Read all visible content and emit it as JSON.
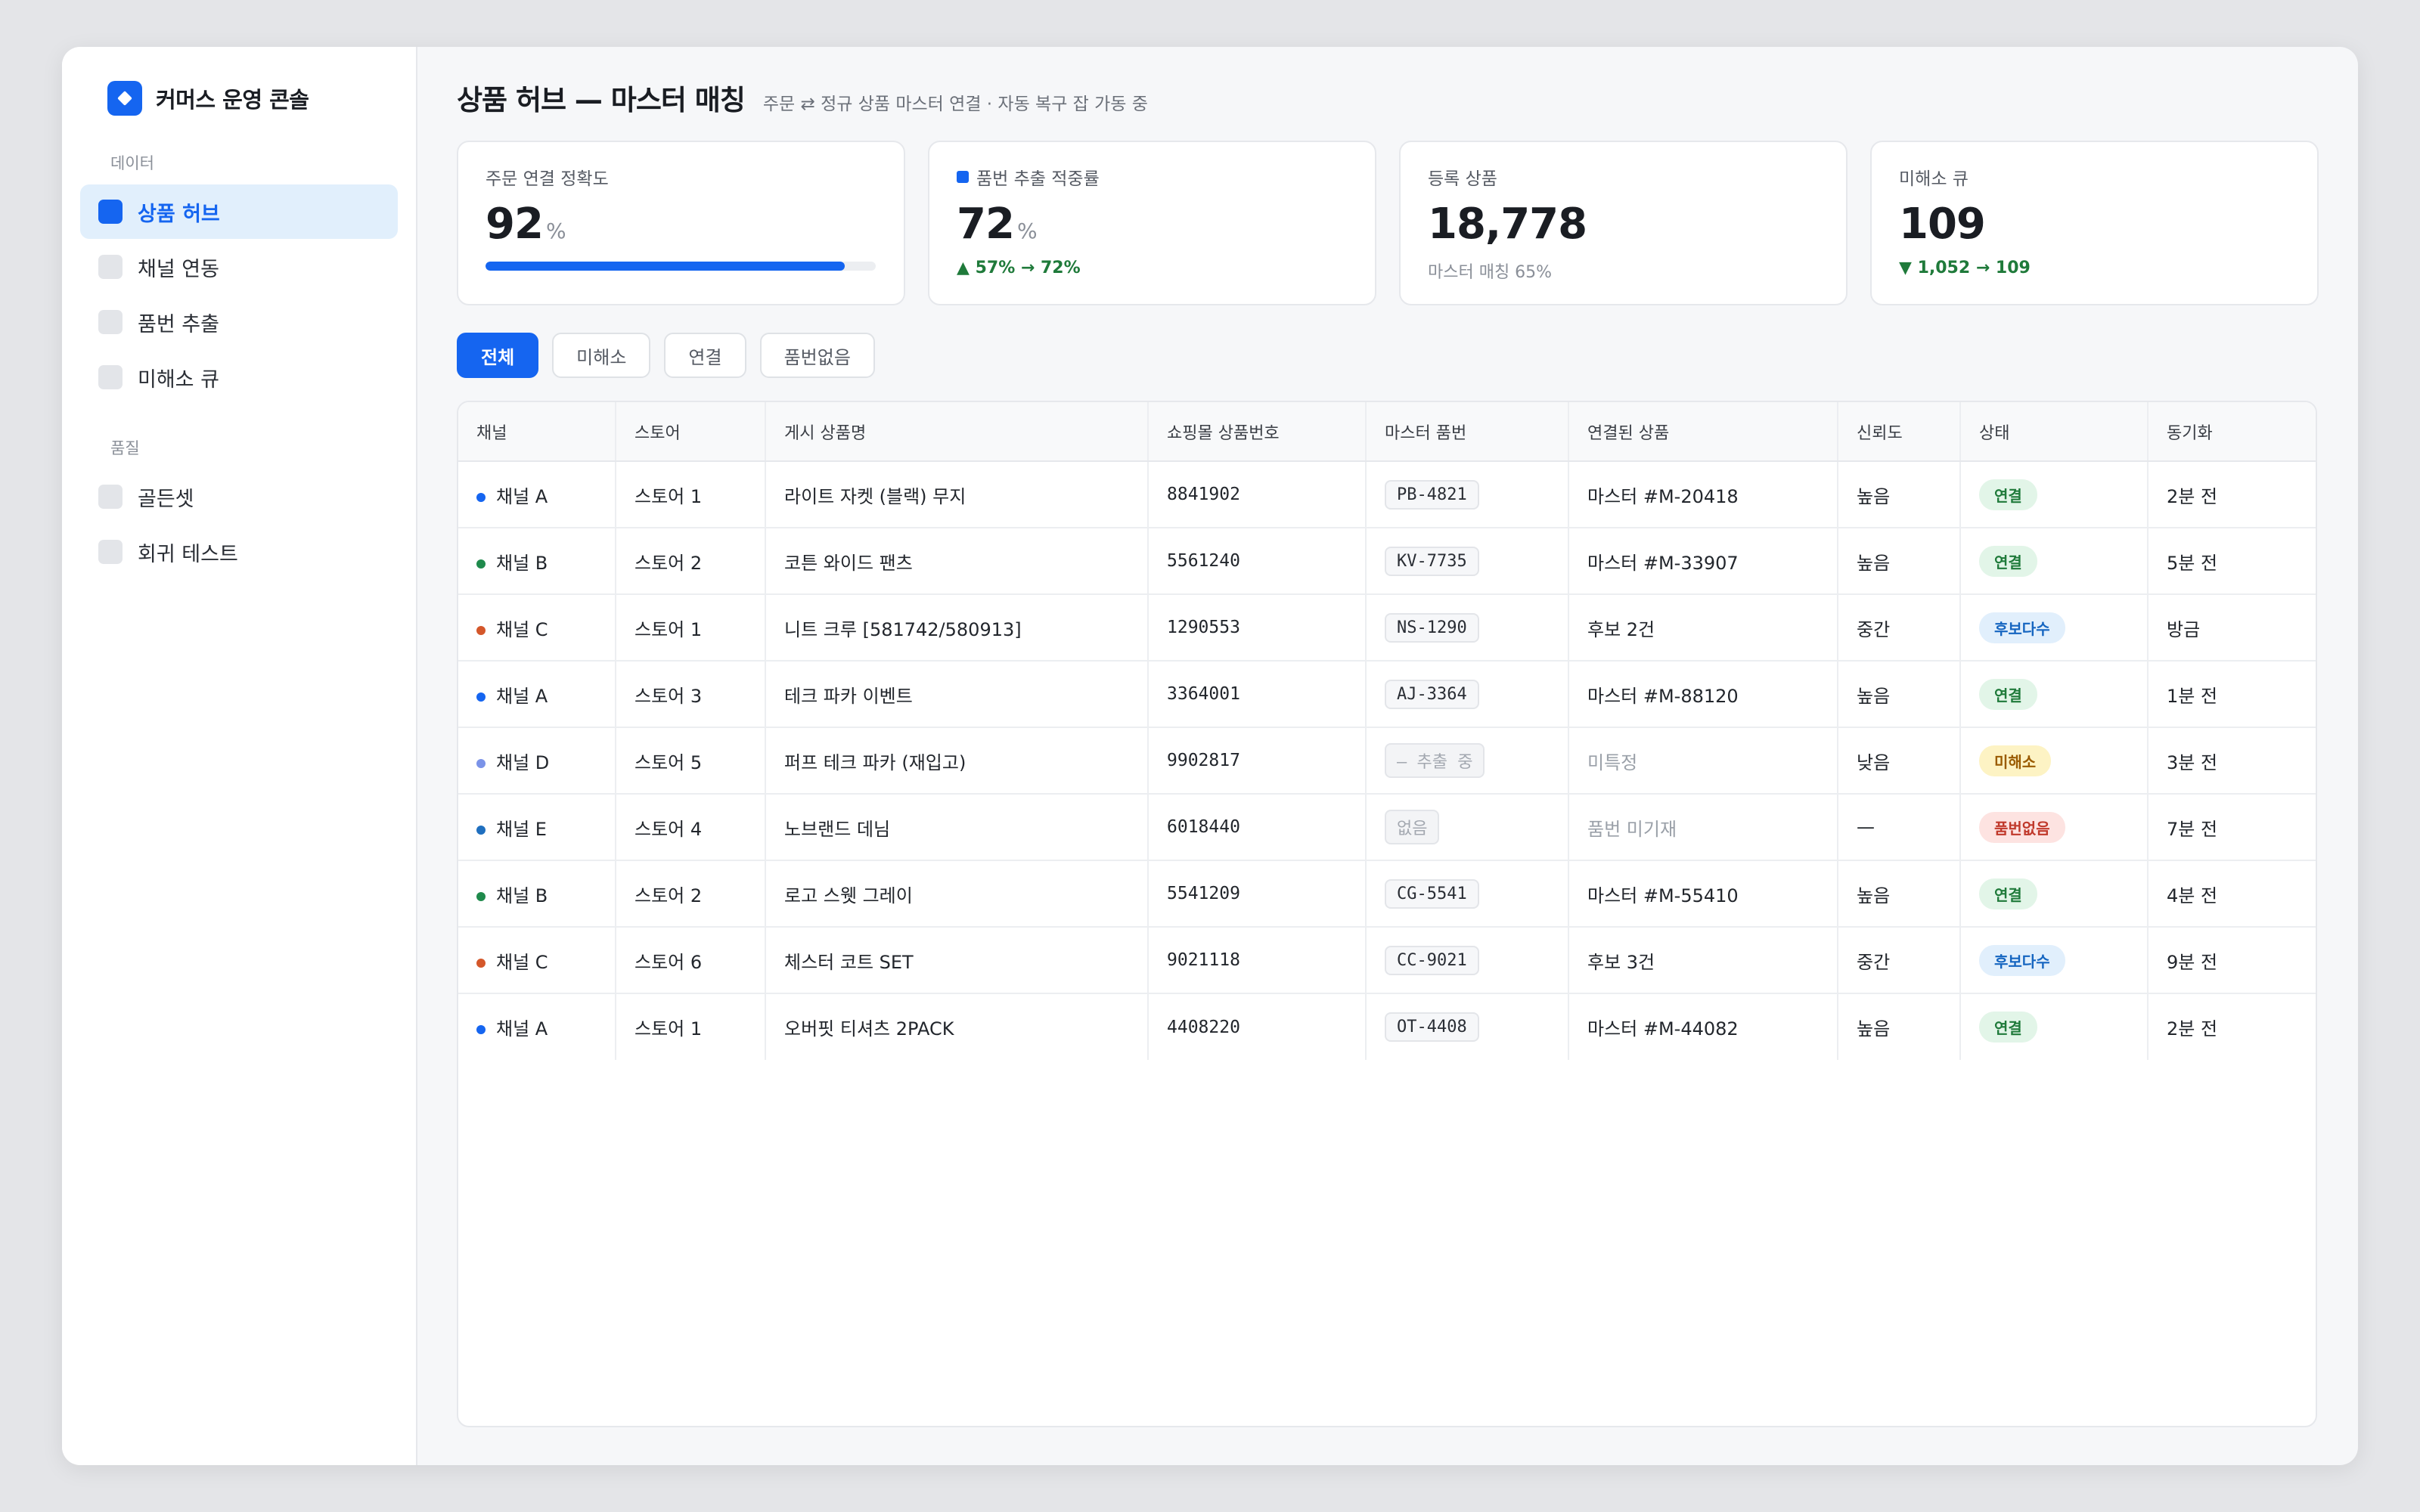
{
  "app": {
    "name": "커머스 운영 콘솔",
    "accent": "#1565f0"
  },
  "sidebar": {
    "sections": [
      {
        "label": "데이터",
        "items": [
          {
            "label": "상품 허브",
            "active": true
          },
          {
            "label": "채널 연동",
            "active": false
          },
          {
            "label": "품번 추출",
            "active": false
          },
          {
            "label": "미해소 큐",
            "active": false
          }
        ]
      },
      {
        "label": "품질",
        "items": [
          {
            "label": "골든셋",
            "active": false
          },
          {
            "label": "회귀 테스트",
            "active": false
          }
        ]
      }
    ]
  },
  "header": {
    "title": "상품 허브 — 마스터 매칭",
    "subtitle": "주문 ⇄ 정규 상품 마스터 연결 · 자동 복구 잡 가동 중"
  },
  "kpis": [
    {
      "label": "주문 연결 정확도",
      "value": "92",
      "unit": "%",
      "progress": 0.92,
      "dot": false
    },
    {
      "label": "품번 추출 적중률",
      "value": "72",
      "unit": "%",
      "delta": "▲ 57% → 72%",
      "dot": true
    },
    {
      "label": "등록 상품",
      "value": "18,778",
      "unit": "",
      "caption": "마스터 매칭 65%",
      "dot": false
    },
    {
      "label": "미해소 큐",
      "value": "109",
      "unit": "",
      "delta": "▼ 1,052 → 109",
      "dot": false
    }
  ],
  "filters": [
    {
      "label": "전체",
      "active": true
    },
    {
      "label": "미해소",
      "active": false
    },
    {
      "label": "연결",
      "active": false
    },
    {
      "label": "품번없음",
      "active": false
    }
  ],
  "table": {
    "columns": [
      "채널",
      "스토어",
      "게시 상품명",
      "쇼핑몰 상품번호",
      "마스터 품번",
      "연결된 상품",
      "신뢰도",
      "상태",
      "동기화"
    ],
    "status_colors": {
      "연결": {
        "bg": "#e2f5e8",
        "fg": "#1f7a3a"
      },
      "후보다수": {
        "bg": "#e1effc",
        "fg": "#1565c0"
      },
      "미해소": {
        "bg": "#fdf3c4",
        "fg": "#9a5b00"
      },
      "품번없음": {
        "bg": "#fde3e1",
        "fg": "#c0392b"
      }
    },
    "rows": [
      {
        "channel": "채널 A",
        "channel_color": "#1565f0",
        "store": "스토어 1",
        "title": "라이트 자켓 (블랙) 무지",
        "mall_no": "8841902",
        "sku": "PB-4821",
        "sku_muted": false,
        "linked": "마스터 #M-20418",
        "linked_muted": false,
        "confidence": "높음",
        "status": "연결",
        "sync": "2분 전"
      },
      {
        "channel": "채널 B",
        "channel_color": "#1f8a4c",
        "store": "스토어 2",
        "title": "코튼 와이드 팬츠",
        "mall_no": "5561240",
        "sku": "KV-7735",
        "sku_muted": false,
        "linked": "마스터 #M-33907",
        "linked_muted": false,
        "confidence": "높음",
        "status": "연결",
        "sync": "5분 전"
      },
      {
        "channel": "채널 C",
        "channel_color": "#d4572a",
        "store": "스토어 1",
        "title": "니트 크루 [581742/580913]",
        "mall_no": "1290553",
        "sku": "NS-1290",
        "sku_muted": false,
        "linked": "후보 2건",
        "linked_muted": false,
        "confidence": "중간",
        "status": "후보다수",
        "sync": "방금"
      },
      {
        "channel": "채널 A",
        "channel_color": "#1565f0",
        "store": "스토어 3",
        "title": "테크 파카 이벤트",
        "mall_no": "3364001",
        "sku": "AJ-3364",
        "sku_muted": false,
        "linked": "마스터 #M-88120",
        "linked_muted": false,
        "confidence": "높음",
        "status": "연결",
        "sync": "1분 전"
      },
      {
        "channel": "채널 D",
        "channel_color": "#7b93e8",
        "store": "스토어 5",
        "title": "퍼프 테크 파카 (재입고)",
        "mall_no": "9902817",
        "sku": "— 추출 중",
        "sku_muted": true,
        "linked": "미특정",
        "linked_muted": true,
        "confidence": "낮음",
        "status": "미해소",
        "sync": "3분 전"
      },
      {
        "channel": "채널 E",
        "channel_color": "#1f6fbf",
        "store": "스토어 4",
        "title": "노브랜드 데님",
        "mall_no": "6018440",
        "sku": "없음",
        "sku_muted": true,
        "linked": "품번 미기재",
        "linked_muted": true,
        "confidence": "—",
        "status": "품번없음",
        "sync": "7분 전"
      },
      {
        "channel": "채널 B",
        "channel_color": "#1f8a4c",
        "store": "스토어 2",
        "title": "로고 스웻 그레이",
        "mall_no": "5541209",
        "sku": "CG-5541",
        "sku_muted": false,
        "linked": "마스터 #M-55410",
        "linked_muted": false,
        "confidence": "높음",
        "status": "연결",
        "sync": "4분 전"
      },
      {
        "channel": "채널 C",
        "channel_color": "#d4572a",
        "store": "스토어 6",
        "title": "체스터 코트 SET",
        "mall_no": "9021118",
        "sku": "CC-9021",
        "sku_muted": false,
        "linked": "후보 3건",
        "linked_muted": false,
        "confidence": "중간",
        "status": "후보다수",
        "sync": "9분 전"
      },
      {
        "channel": "채널 A",
        "channel_color": "#1565f0",
        "store": "스토어 1",
        "title": "오버핏 티셔츠 2PACK",
        "mall_no": "4408220",
        "sku": "OT-4408",
        "sku_muted": false,
        "linked": "마스터 #M-44082",
        "linked_muted": false,
        "confidence": "높음",
        "status": "연결",
        "sync": "2분 전"
      }
    ]
  }
}
